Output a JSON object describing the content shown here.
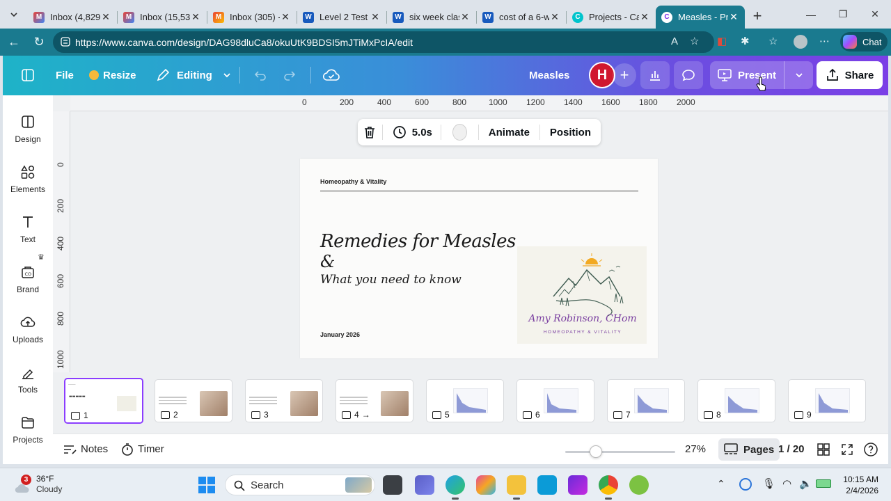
{
  "browser": {
    "tabs": [
      {
        "label": "Inbox (4,829) -",
        "icon": "gmail-icon"
      },
      {
        "label": "Inbox (15,531) -",
        "icon": "gmail-icon"
      },
      {
        "label": "Inbox (305) -",
        "icon": "gmail-icon"
      },
      {
        "label": "Level 2 Test P",
        "icon": "word-icon"
      },
      {
        "label": "six week class",
        "icon": "word-icon"
      },
      {
        "label": "cost of a 6-we",
        "icon": "word-icon"
      },
      {
        "label": "Projects - Can",
        "icon": "canva-icon"
      },
      {
        "label": "Measles - Pre",
        "icon": "canva-icon"
      }
    ],
    "url": "https://www.canva.com/design/DAG98dluCa8/okuUtK9BDSI5mJTiMxPcIA/edit",
    "copilot_label": "Chat"
  },
  "header": {
    "file": "File",
    "resize": "Resize",
    "editing": "Editing",
    "design_title": "Measles",
    "avatar_letter": "H",
    "present": "Present",
    "share": "Share"
  },
  "sidebar": {
    "items": [
      {
        "label": "Design"
      },
      {
        "label": "Elements"
      },
      {
        "label": "Text"
      },
      {
        "label": "Brand"
      },
      {
        "label": "Uploads"
      },
      {
        "label": "Tools"
      },
      {
        "label": "Projects"
      }
    ]
  },
  "ruler": {
    "h_ticks": [
      "0",
      "200",
      "400",
      "600",
      "800",
      "1000",
      "1200",
      "1400",
      "1600",
      "1800",
      "2000"
    ],
    "v_ticks": [
      "0",
      "200",
      "400",
      "600",
      "800",
      "1000"
    ]
  },
  "toolbar": {
    "duration": "5.0s",
    "animate": "Animate",
    "position": "Position"
  },
  "slide": {
    "brand": "Homeopathy & Vitality",
    "title_line1": "Remedies for Measles",
    "title_line2": "&",
    "title_line3": "What you need to know",
    "date": "January 2026",
    "logo_name": "Amy Robinson, CHom",
    "logo_tagline": "HOMEOPATHY & VITALITY"
  },
  "pages": [
    {
      "num": "1"
    },
    {
      "num": "2"
    },
    {
      "num": "3"
    },
    {
      "num": "4"
    },
    {
      "num": "5"
    },
    {
      "num": "6"
    },
    {
      "num": "7"
    },
    {
      "num": "8"
    },
    {
      "num": "9"
    }
  ],
  "footer": {
    "notes": "Notes",
    "timer": "Timer",
    "zoom": "27%",
    "pages": "Pages",
    "page_count": "1 / 20"
  },
  "taskbar": {
    "weather_temp": "36°F",
    "weather_desc": "Cloudy",
    "weather_badge": "3",
    "search": "Search",
    "time": "10:15 AM",
    "date": "2/4/2026"
  },
  "colors": {
    "accent_purple": "#8b3dff",
    "avatar_red": "#d0182f",
    "browser_teal": "#1a7a8f"
  }
}
